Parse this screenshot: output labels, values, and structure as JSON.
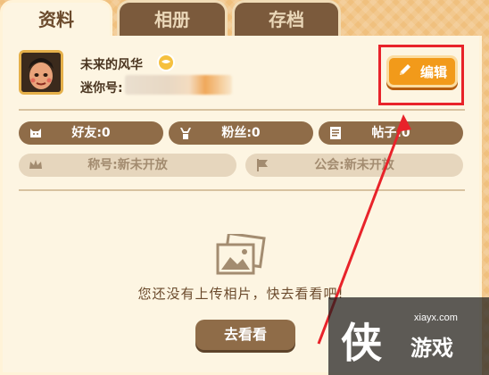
{
  "tabs": [
    {
      "label": "资料"
    },
    {
      "label": "相册"
    },
    {
      "label": "存档"
    }
  ],
  "profile": {
    "nickname": "未来的风华",
    "mini_id_label": "迷你号:",
    "edit_label": "编辑"
  },
  "stats": {
    "friends": "好友:0",
    "fans": "粉丝:0",
    "posts": "帖子:0",
    "title": "称号:新未开放",
    "guild": "公会:新未开放"
  },
  "album": {
    "empty_text": "您还没有上传相片，快去看看吧!",
    "go_label": "去看看"
  },
  "watermark": {
    "site": "xiayx.com",
    "big": "侠",
    "small": "游戏"
  },
  "colors": {
    "accent": "#f29a1a",
    "highlight": "#e8232a",
    "stat_bg": "#8f6c48"
  }
}
